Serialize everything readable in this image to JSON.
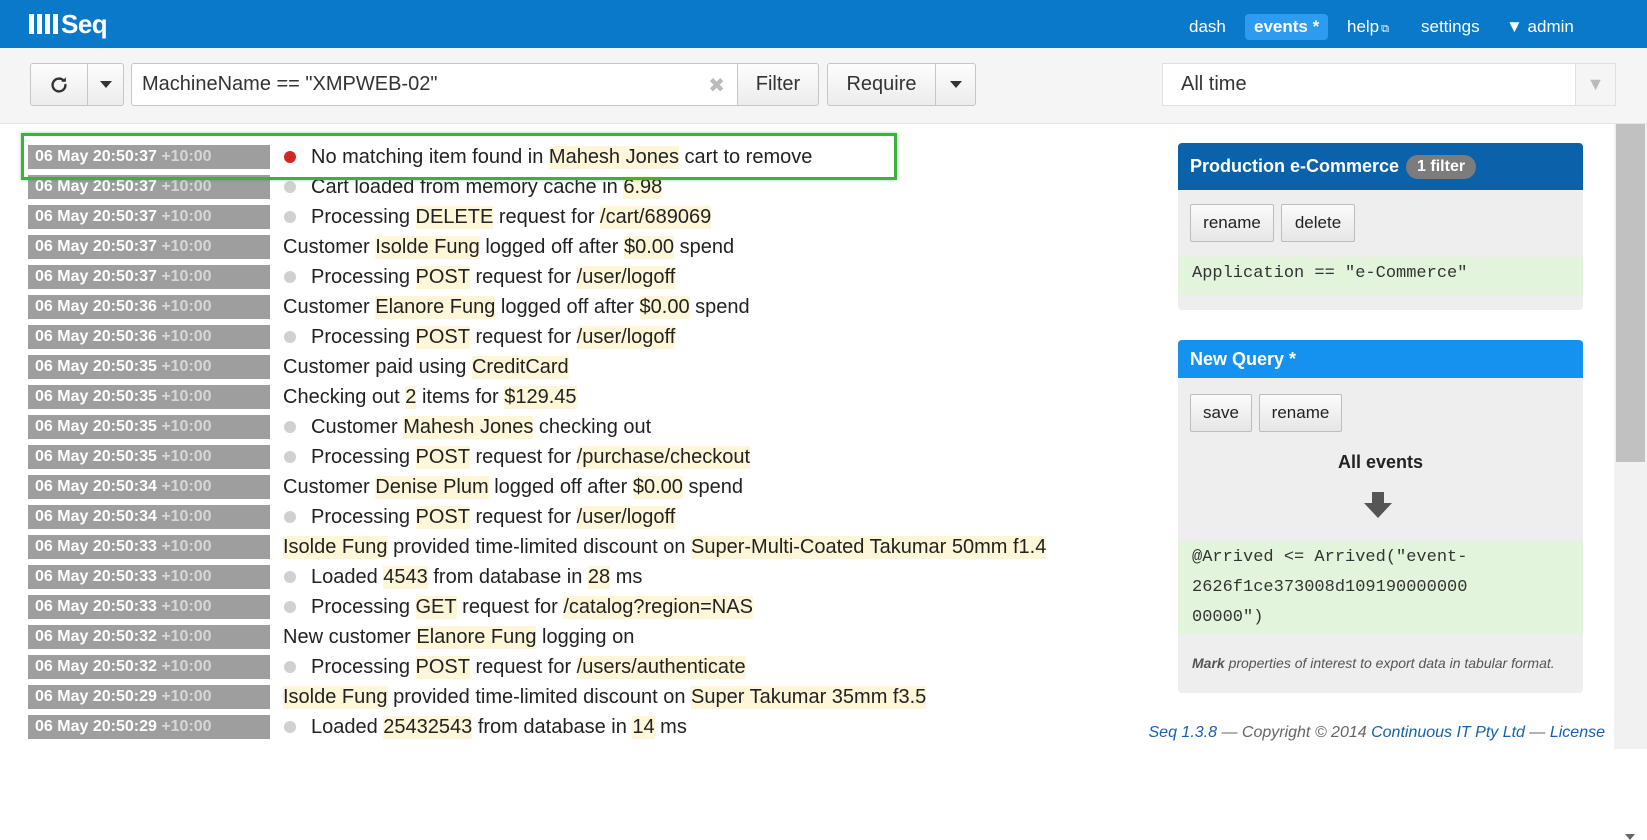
{
  "app": {
    "logo": "Seq"
  },
  "nav": {
    "dash": "dash",
    "events": "events *",
    "help": "help",
    "settings": "settings",
    "user": "▼ admin"
  },
  "toolbar": {
    "filter_query": "MachineName == \"XMPWEB-02\"",
    "clear": "✖",
    "filter_label": "Filter",
    "require_label": "Require",
    "time_range": "All time",
    "time_arrow": "▼"
  },
  "events": [
    {
      "date": "06 May 20:50:37",
      "tz": "+10:00",
      "level": "error",
      "parts": [
        [
          "No matching item found in ",
          false
        ],
        [
          "Mahesh Jones",
          true
        ],
        [
          " cart to remove",
          false
        ]
      ]
    },
    {
      "date": "06 May 20:50:37",
      "tz": "+10:00",
      "level": "debug",
      "parts": [
        [
          "Cart loaded from memory cache in ",
          false
        ],
        [
          "6.98",
          true
        ]
      ]
    },
    {
      "date": "06 May 20:50:37",
      "tz": "+10:00",
      "level": "debug",
      "parts": [
        [
          "Processing ",
          false
        ],
        [
          "DELETE",
          true
        ],
        [
          " request for ",
          false
        ],
        [
          "/cart/689069",
          true
        ]
      ]
    },
    {
      "date": "06 May 20:50:37",
      "tz": "+10:00",
      "level": "info",
      "parts": [
        [
          "Customer ",
          false
        ],
        [
          "Isolde Fung",
          true
        ],
        [
          " logged off after ",
          false
        ],
        [
          "$0.00",
          true
        ],
        [
          " spend",
          false
        ]
      ]
    },
    {
      "date": "06 May 20:50:37",
      "tz": "+10:00",
      "level": "debug",
      "parts": [
        [
          "Processing ",
          false
        ],
        [
          "POST",
          true
        ],
        [
          " request for ",
          false
        ],
        [
          "/user/logoff",
          true
        ]
      ]
    },
    {
      "date": "06 May 20:50:36",
      "tz": "+10:00",
      "level": "info",
      "parts": [
        [
          "Customer ",
          false
        ],
        [
          "Elanore Fung",
          true
        ],
        [
          " logged off after ",
          false
        ],
        [
          "$0.00",
          true
        ],
        [
          " spend",
          false
        ]
      ]
    },
    {
      "date": "06 May 20:50:36",
      "tz": "+10:00",
      "level": "debug",
      "parts": [
        [
          "Processing ",
          false
        ],
        [
          "POST",
          true
        ],
        [
          " request for ",
          false
        ],
        [
          "/user/logoff",
          true
        ]
      ]
    },
    {
      "date": "06 May 20:50:35",
      "tz": "+10:00",
      "level": "info",
      "parts": [
        [
          "Customer paid using ",
          false
        ],
        [
          "CreditCard",
          true
        ]
      ]
    },
    {
      "date": "06 May 20:50:35",
      "tz": "+10:00",
      "level": "info",
      "parts": [
        [
          "Checking out ",
          false
        ],
        [
          "2",
          true
        ],
        [
          " items for ",
          false
        ],
        [
          "$129.45",
          true
        ]
      ]
    },
    {
      "date": "06 May 20:50:35",
      "tz": "+10:00",
      "level": "debug",
      "parts": [
        [
          "Customer ",
          false
        ],
        [
          "Mahesh Jones",
          true
        ],
        [
          " checking out",
          false
        ]
      ]
    },
    {
      "date": "06 May 20:50:35",
      "tz": "+10:00",
      "level": "debug",
      "parts": [
        [
          "Processing ",
          false
        ],
        [
          "POST",
          true
        ],
        [
          " request for ",
          false
        ],
        [
          "/purchase/checkout",
          true
        ]
      ]
    },
    {
      "date": "06 May 20:50:34",
      "tz": "+10:00",
      "level": "info",
      "parts": [
        [
          "Customer ",
          false
        ],
        [
          "Denise Plum",
          true
        ],
        [
          " logged off after ",
          false
        ],
        [
          "$0.00",
          true
        ],
        [
          " spend",
          false
        ]
      ]
    },
    {
      "date": "06 May 20:50:34",
      "tz": "+10:00",
      "level": "debug",
      "parts": [
        [
          "Processing ",
          false
        ],
        [
          "POST",
          true
        ],
        [
          " request for ",
          false
        ],
        [
          "/user/logoff",
          true
        ]
      ]
    },
    {
      "date": "06 May 20:50:33",
      "tz": "+10:00",
      "level": "info",
      "parts": [
        [
          "Isolde Fung",
          true
        ],
        [
          " provided time-limited discount on ",
          false
        ],
        [
          "Super-Multi-Coated Takumar 50mm f1.4",
          true
        ]
      ]
    },
    {
      "date": "06 May 20:50:33",
      "tz": "+10:00",
      "level": "debug",
      "parts": [
        [
          "Loaded ",
          false
        ],
        [
          "4543",
          true
        ],
        [
          " from database in ",
          false
        ],
        [
          "28",
          true
        ],
        [
          " ms",
          false
        ]
      ]
    },
    {
      "date": "06 May 20:50:33",
      "tz": "+10:00",
      "level": "debug",
      "parts": [
        [
          "Processing ",
          false
        ],
        [
          "GET",
          true
        ],
        [
          " request for ",
          false
        ],
        [
          "/catalog?region=NAS",
          true
        ]
      ]
    },
    {
      "date": "06 May 20:50:32",
      "tz": "+10:00",
      "level": "info",
      "parts": [
        [
          "New customer ",
          false
        ],
        [
          "Elanore Fung",
          true
        ],
        [
          " logging on",
          false
        ]
      ]
    },
    {
      "date": "06 May 20:50:32",
      "tz": "+10:00",
      "level": "debug",
      "parts": [
        [
          "Processing ",
          false
        ],
        [
          "POST",
          true
        ],
        [
          " request for ",
          false
        ],
        [
          "/users/authenticate",
          true
        ]
      ]
    },
    {
      "date": "06 May 20:50:29",
      "tz": "+10:00",
      "level": "info",
      "parts": [
        [
          "Isolde Fung",
          true
        ],
        [
          " provided time-limited discount on ",
          false
        ],
        [
          "Super Takumar 35mm f3.5",
          true
        ]
      ]
    },
    {
      "date": "06 May 20:50:29",
      "tz": "+10:00",
      "level": "debug",
      "parts": [
        [
          "Loaded ",
          false
        ],
        [
          "25432543",
          true
        ],
        [
          " from database in ",
          false
        ],
        [
          "14",
          true
        ],
        [
          " ms",
          false
        ]
      ]
    }
  ],
  "panel1": {
    "title": "Production e-Commerce",
    "badge": "1 filter",
    "rename": "rename",
    "delete": "delete",
    "query": "Application == \"e-Commerce\"",
    "color": "#0a63aa"
  },
  "panel2": {
    "title": "New Query *",
    "save": "save",
    "rename": "rename",
    "all_events": "All events",
    "query": "@Arrived <= Arrived(\"event-2626f1ce373008d109190000000 00000\")",
    "query_lines": [
      "@Arrived <= Arrived(\"event-",
      "2626f1ce373008d109190000000",
      "00000\")"
    ],
    "hint_bold": "Mark",
    "hint_rest": " properties of interest to export data in tabular format.",
    "color": "#1591f0"
  },
  "footer": {
    "version": "Seq 1.3.8",
    "copyright": " — Copyright © 2014 ",
    "company": "Continuous IT Pty Ltd",
    "sep": " — ",
    "license": "License"
  }
}
